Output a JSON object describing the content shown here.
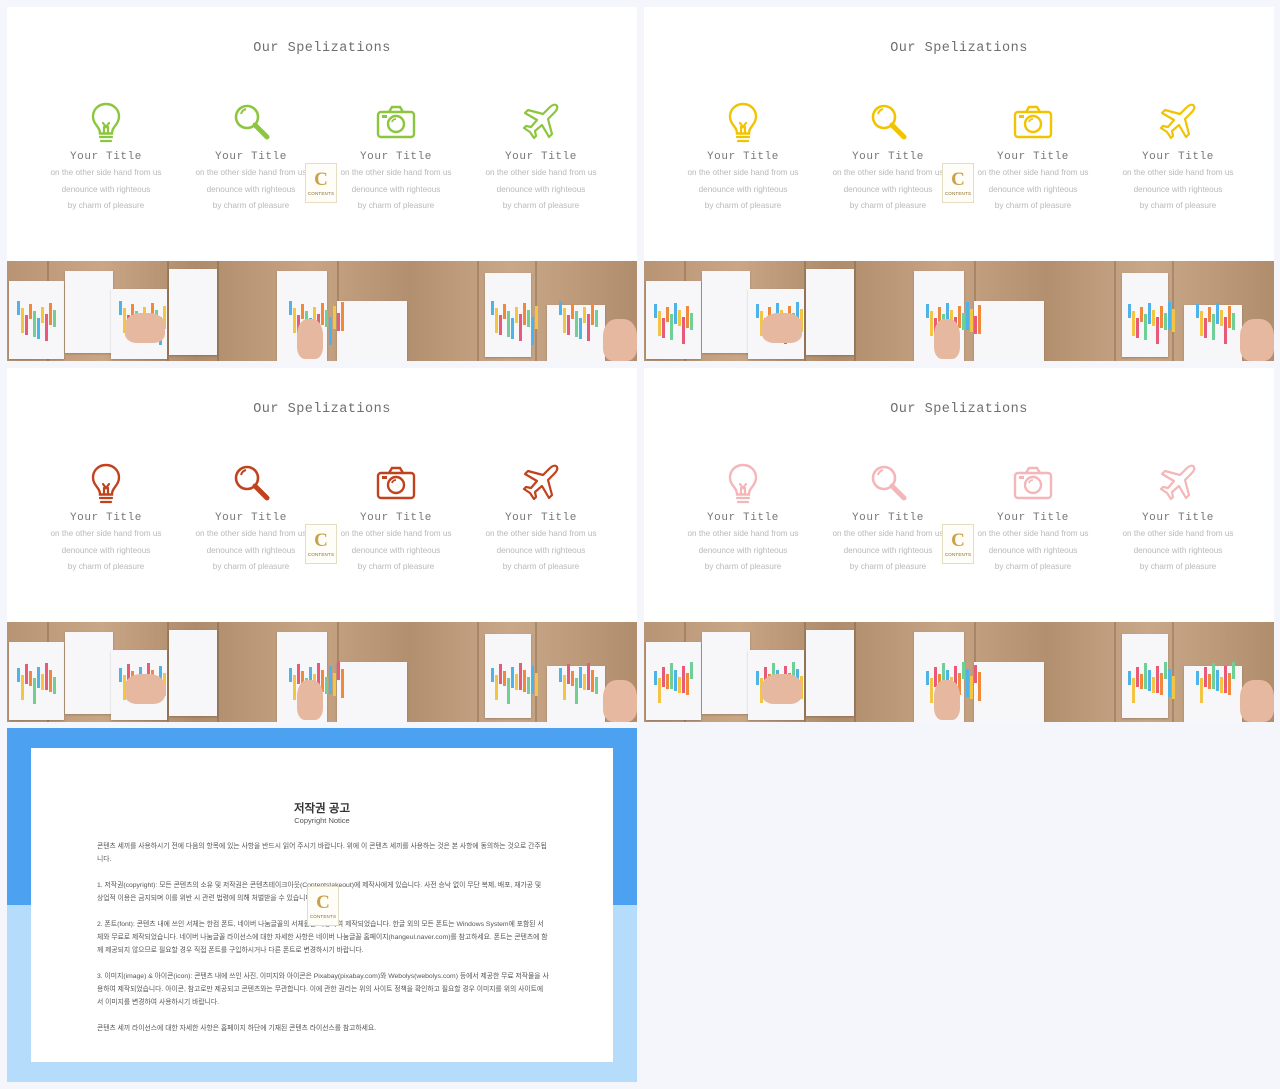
{
  "slides": [
    {
      "title": "Our Spelizations",
      "color": "#8cc63f",
      "items": [
        {
          "icon": "lightbulb-icon",
          "title": "Your Title",
          "desc": [
            "on the other side hand from us",
            "denounce with righteous",
            "by charm of pleasure"
          ]
        },
        {
          "icon": "magnifier-icon",
          "title": "Your Title",
          "desc": [
            "on the other side hand from us",
            "denounce with righteous",
            "by charm of pleasure"
          ]
        },
        {
          "icon": "camera-icon",
          "title": "Your Title",
          "desc": [
            "on the other side hand from us",
            "denounce with righteous",
            "by charm of pleasure"
          ]
        },
        {
          "icon": "airplane-icon",
          "title": "Your Title",
          "desc": [
            "on the other side hand from us",
            "denounce with righteous",
            "by charm of pleasure"
          ]
        }
      ]
    },
    {
      "title": "Our Spelizations",
      "color": "#f2c300",
      "items": [
        {
          "icon": "lightbulb-icon",
          "title": "Your Title",
          "desc": [
            "on the other side hand from us",
            "denounce with righteous",
            "by charm of pleasure"
          ]
        },
        {
          "icon": "magnifier-icon",
          "title": "Your Title",
          "desc": [
            "on the other side hand from us",
            "denounce with righteous",
            "by charm of pleasure"
          ]
        },
        {
          "icon": "camera-icon",
          "title": "Your Title",
          "desc": [
            "on the other side hand from us",
            "denounce with righteous",
            "by charm of pleasure"
          ]
        },
        {
          "icon": "airplane-icon",
          "title": "Your Title",
          "desc": [
            "on the other side hand from us",
            "denounce with righteous",
            "by charm of pleasure"
          ]
        }
      ]
    },
    {
      "title": "Our Spelizations",
      "color": "#c0431d",
      "items": [
        {
          "icon": "lightbulb-icon",
          "title": "Your Title",
          "desc": [
            "on the other side hand from us",
            "denounce with righteous",
            "by charm of pleasure"
          ]
        },
        {
          "icon": "magnifier-icon",
          "title": "Your Title",
          "desc": [
            "on the other side hand from us",
            "denounce with righteous",
            "by charm of pleasure"
          ]
        },
        {
          "icon": "camera-icon",
          "title": "Your Title",
          "desc": [
            "on the other side hand from us",
            "denounce with righteous",
            "by charm of pleasure"
          ]
        },
        {
          "icon": "airplane-icon",
          "title": "Your Title",
          "desc": [
            "on the other side hand from us",
            "denounce with righteous",
            "by charm of pleasure"
          ]
        }
      ]
    },
    {
      "title": "Our Spelizations",
      "color": "#f4b6b8",
      "items": [
        {
          "icon": "lightbulb-icon",
          "title": "Your Title",
          "desc": [
            "on the other side hand from us",
            "denounce with righteous",
            "by charm of pleasure"
          ]
        },
        {
          "icon": "magnifier-icon",
          "title": "Your Title",
          "desc": [
            "on the other side hand from us",
            "denounce with righteous",
            "by charm of pleasure"
          ]
        },
        {
          "icon": "camera-icon",
          "title": "Your Title",
          "desc": [
            "on the other side hand from us",
            "denounce with righteous",
            "by charm of pleasure"
          ]
        },
        {
          "icon": "airplane-icon",
          "title": "Your Title",
          "desc": [
            "on the other side hand from us",
            "denounce with righteous",
            "by charm of pleasure"
          ]
        }
      ]
    }
  ],
  "logo": {
    "letter": "C",
    "wordmark": "CONTENTS"
  },
  "notice": {
    "title": "저작권 공고",
    "subtitle": "Copyright Notice",
    "paragraphs": [
      "콘텐츠 세끼를 사용하시기 전에 다음의 항목에 있는 사항을 반드시 읽어 주시기 바랍니다. 위에 이 콘텐츠 세끼를 사용하는 것은 본 사항에 동의하는 것으로 간주됩니다.",
      "1. 저작권(copyright): 모든 콘텐츠의 소유 및 저작권은 콘텐츠테이크아웃(Contentstakeout)에 제작사에게 있습니다. 사전 승낙 없이 무단 복제, 배포, 재가공 및 상업적 이용은 금지되며 이를 위반 시 관련 법령에 의해 처벌받을 수 있습니다.",
      "2. 폰트(font): 콘텐츠 내에 쓰인 서체는 한컴 폰트, 네이버 나눔글꼴의 서체들을 사용하여 제작되었습니다. 한글 외의 모든 폰트는 Windows System에 포함된 서체와 무료로 제작되었습니다. 네이버 나눔글꼴 라이선스에 대한 자세한 사항은 네이버 나눔글꼴 홈페이지(hangeul.naver.com)를 참고하세요. 폰트는 콘텐츠에 함께 제공되지 않으므로 필요할 경우 직접 폰트를 구입하시거나 다른 폰트로 변경하시기 바랍니다.",
      "3. 이미지(image) & 아이콘(icon): 콘텐츠 내에 쓰인 사진, 이미지와 아이콘은 Pixabay(pixabay.com)와 Webolys(webolys.com) 등에서 제공한 무료 저작물을 사용하여 제작되었습니다. 아이콘, 참고로만 제공되고 콘텐츠와는 무관합니다. 이에 관한 권리는 위의 사이트 정책을 확인하고 필요할 경우 이미지를 위의 사이트에서 이미지를 변경하여 사용하시기 바랍니다.",
      "콘텐츠 세끼 라이선스에 대한 자세한 사항은 홈페이지 하단에 기재된 콘텐츠 라이선스를 참고하세요."
    ]
  }
}
